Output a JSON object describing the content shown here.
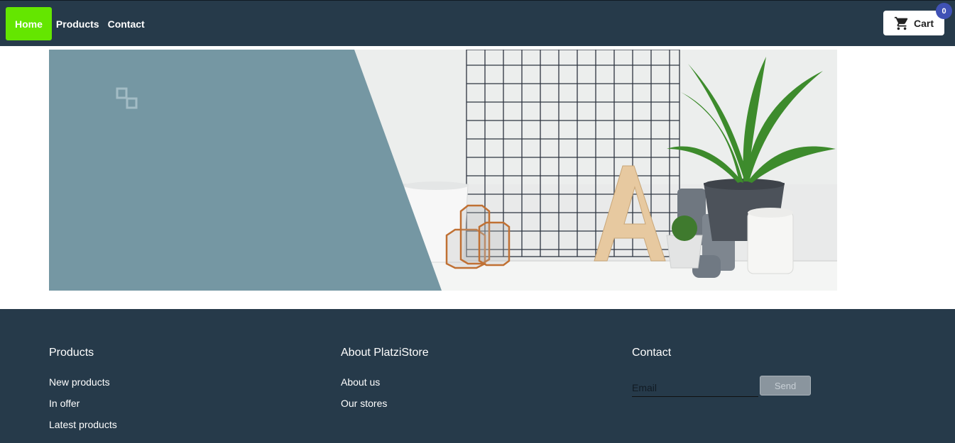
{
  "nav": {
    "home": "Home",
    "products": "Products",
    "contact": "Contact",
    "cart_label": "Cart",
    "cart_count": "0"
  },
  "banner": {
    "description": "hero banner with plant, wire grid, letter A, candles",
    "panel_color": "#7597a3"
  },
  "footer": {
    "products": {
      "title": "Products",
      "links": [
        "New products",
        "In offer",
        "Latest products"
      ]
    },
    "about": {
      "title": "About PlatziStore",
      "links": [
        "About us",
        "Our stores"
      ]
    },
    "contact": {
      "title": "Contact",
      "email_placeholder": "Email",
      "send_label": "Send"
    }
  },
  "colors": {
    "header_bg": "#263a4a",
    "home_button": "#64e600",
    "badge": "#3f51b5",
    "footer_bg": "#263a4a"
  }
}
